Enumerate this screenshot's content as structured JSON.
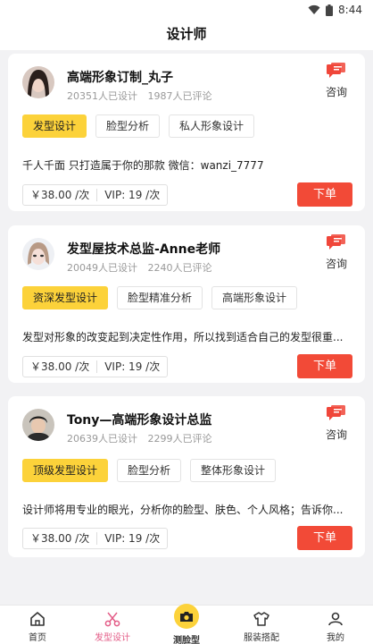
{
  "status": {
    "time": "8:44"
  },
  "header": {
    "title": "设计师"
  },
  "designers": [
    {
      "name": "高端形象订制_丸子",
      "designs": "20351人已设计",
      "comments": "1987人已评论",
      "consult_label": "咨询",
      "tags": [
        "发型设计",
        "脸型分析",
        "私人形象设计"
      ],
      "description": "千人千面 只打造属于你的那款 微信：wanzi_7777",
      "price": "￥38.00 /次",
      "vip": "VIP: 19 /次",
      "order_label": "下单"
    },
    {
      "name": "发型屋技术总监-Anne老师",
      "designs": "20049人已设计",
      "comments": "2240人已评论",
      "consult_label": "咨询",
      "tags": [
        "资深发型设计",
        "脸型精准分析",
        "高端形象设计"
      ],
      "description": "发型对形象的改变起到决定性作用，所以找到适合自己的发型很重...",
      "price": "￥38.00 /次",
      "vip": "VIP: 19 /次",
      "order_label": "下单"
    },
    {
      "name": "Tony—高端形象设计总监",
      "designs": "20639人已设计",
      "comments": "2299人已评论",
      "consult_label": "咨询",
      "tags": [
        "顶级发型设计",
        "脸型分析",
        "整体形象设计"
      ],
      "description": "设计师将用专业的眼光，分析你的脸型、肤色、个人风格；告诉你...",
      "price": "￥38.00 /次",
      "vip": "VIP: 19 /次",
      "order_label": "下单"
    }
  ],
  "tabbar": {
    "items": [
      {
        "label": "首页",
        "icon": "home-icon"
      },
      {
        "label": "发型设计",
        "icon": "scissors-icon",
        "active": true
      },
      {
        "label": "测脸型",
        "icon": "camera-icon"
      },
      {
        "label": "服装搭配",
        "icon": "shirt-icon"
      },
      {
        "label": "我的",
        "icon": "user-icon"
      }
    ]
  },
  "colors": {
    "accent_yellow": "#fcd23a",
    "order_red": "#f24a37",
    "active_tab_pink": "#e35b86",
    "consult_icon_red": "#f0463a"
  }
}
